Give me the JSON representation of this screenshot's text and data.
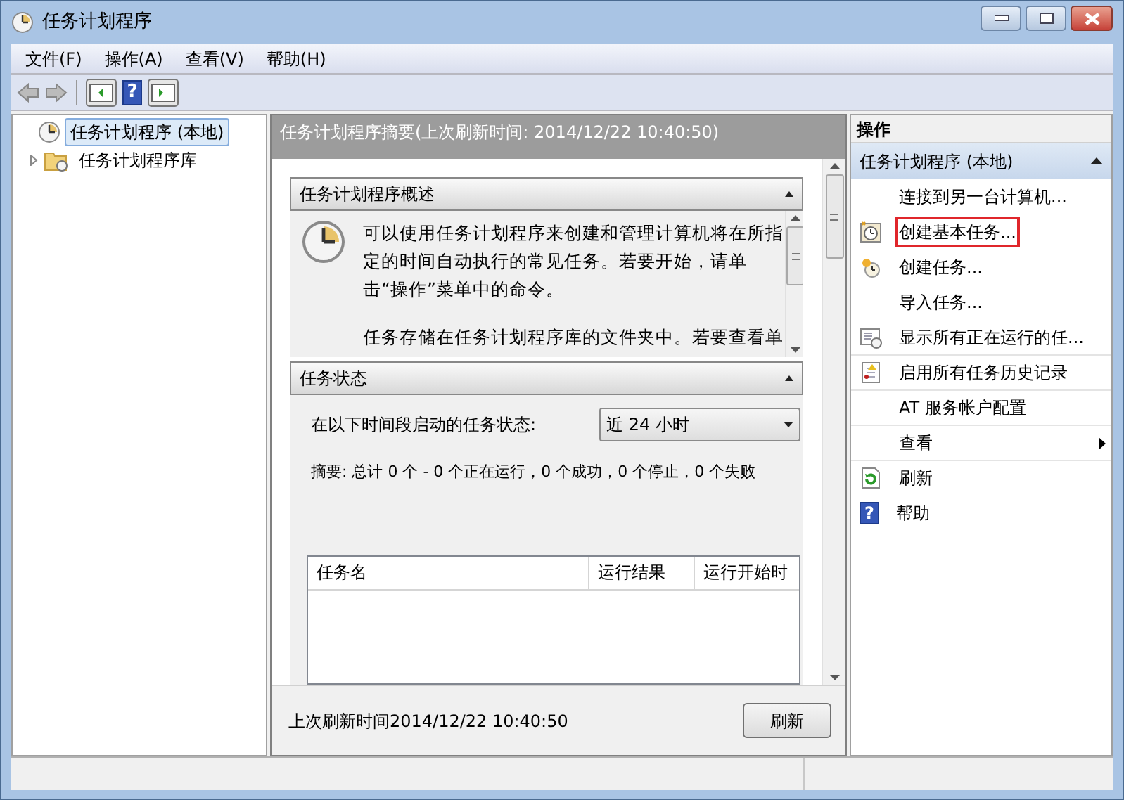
{
  "window": {
    "title": "任务计划程序"
  },
  "menu": [
    "文件(F)",
    "操作(A)",
    "查看(V)",
    "帮助(H)"
  ],
  "toolbar": {
    "help_glyph": "?"
  },
  "tree": [
    {
      "label": "任务计划程序 (本地)",
      "selected": true,
      "children": [
        {
          "label": "任务计划程序库",
          "selected": false,
          "expanded": false
        }
      ]
    }
  ],
  "summary": {
    "header": "任务计划程序摘要(上次刷新时间: 2014/12/22 10:40:50)",
    "overview": {
      "title": "任务计划程序概述",
      "paragraphs": [
        "可以使用任务计划程序来创建和管理计算机将在所指定的时间自动执行的常见任务。若要开始，请单击“操作”菜单中的命令。",
        "任务存储在任务计划程序库的文件夹中。若要查看单"
      ]
    },
    "status": {
      "title": "任务状态",
      "period_label": "在以下时间段启动的任务状态:",
      "period_value": "近 24 小时",
      "summary": "摘要: 总计 0 个 - 0 个正在运行，0 个成功，0 个停止，0 个失败",
      "columns": [
        "任务名",
        "运行结果",
        "运行开始时"
      ]
    },
    "last_refresh": "上次刷新时间2014/12/22 10:40:50",
    "refresh_button": "刷新"
  },
  "actions": {
    "title": "操作",
    "group": "任务计划程序 (本地)",
    "items": [
      {
        "label": "连接到另一台计算机...",
        "kind": "action",
        "highlighted": false
      },
      {
        "label": "创建基本任务...",
        "kind": "action",
        "highlighted": true
      },
      {
        "label": "创建任务...",
        "kind": "action",
        "highlighted": false
      },
      {
        "label": "导入任务...",
        "kind": "action",
        "highlighted": false
      },
      {
        "label": "显示所有正在运行的任...",
        "kind": "action",
        "highlighted": false
      },
      {
        "label": "启用所有任务历史记录",
        "kind": "action",
        "highlighted": false
      },
      {
        "label": "AT 服务帐户配置",
        "kind": "action",
        "highlighted": false
      },
      {
        "label": "查看",
        "kind": "submenu",
        "highlighted": false
      },
      {
        "label": "刷新",
        "kind": "action",
        "highlighted": false
      },
      {
        "label": "帮助",
        "kind": "action",
        "highlighted": false,
        "glyph": "?"
      }
    ]
  }
}
